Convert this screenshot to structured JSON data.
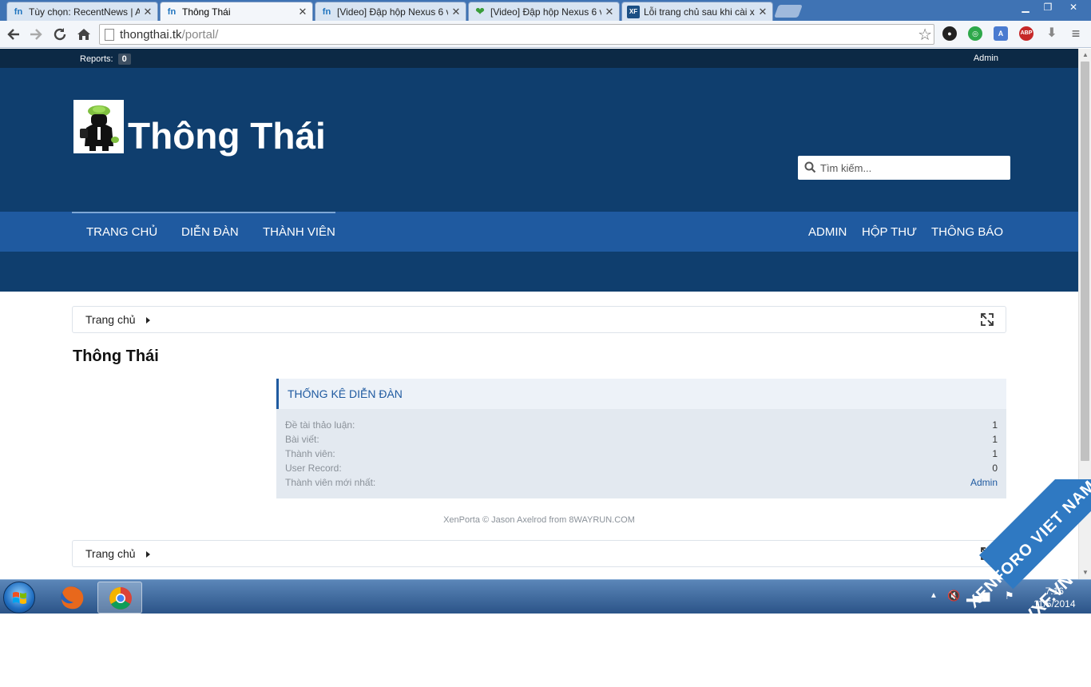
{
  "browser": {
    "tabs": [
      {
        "title": "Tùy chọn: RecentNews | A",
        "icon": "fn"
      },
      {
        "title": "Thông Thái",
        "icon": "fn"
      },
      {
        "title": "[Video] Đập hộp Nexus 6 v",
        "icon": "fn"
      },
      {
        "title": "[Video] Đập hộp Nexus 6 v",
        "icon": "heart"
      },
      {
        "title": "Lỗi trang chủ sau khi cài x",
        "icon": "xf"
      }
    ],
    "active_tab": 1,
    "url_host": "thongthai.tk",
    "url_path": "/portal/",
    "extensions": [
      {
        "name": "ext-dark",
        "color": "#222222"
      },
      {
        "name": "ext-green",
        "color": "#2ea84a"
      },
      {
        "name": "ext-translate",
        "color": "#4a7bd0"
      },
      {
        "name": "ext-abp",
        "color": "#c62828",
        "label": "ABP"
      },
      {
        "name": "ext-download",
        "color": "#888888"
      }
    ]
  },
  "adminbar": {
    "reports_label": "Reports:",
    "reports_count": "0",
    "user": "Admin"
  },
  "header": {
    "site_title": "Thông Thái",
    "search_placeholder": "Tìm kiếm..."
  },
  "nav": {
    "left": [
      "Trang chủ",
      "Diễn đàn",
      "Thành viên"
    ],
    "right": [
      "Admin",
      "Hộp thư",
      "Thông báo"
    ]
  },
  "breadcrumb": {
    "home": "Trang chủ"
  },
  "page_title": "Thông Thái",
  "stats": {
    "heading": "Thống kê diễn đàn",
    "rows": [
      {
        "label": "Đề tài thảo luận:",
        "value": "1"
      },
      {
        "label": "Bài viết:",
        "value": "1"
      },
      {
        "label": "Thành viên:",
        "value": "1"
      },
      {
        "label": "User Record:",
        "value": "0"
      },
      {
        "label": "Thành viên mới nhất:",
        "value": "Admin"
      }
    ]
  },
  "copyright": "XenPorta © Jason Axelrod from 8WAYRUN.COM",
  "taskbar": {
    "clock_time": "7:16",
    "clock_date": "11/5/2014"
  },
  "watermark": {
    "line1": "XENFORO VIET NAM",
    "line2": "VXF.VN"
  }
}
